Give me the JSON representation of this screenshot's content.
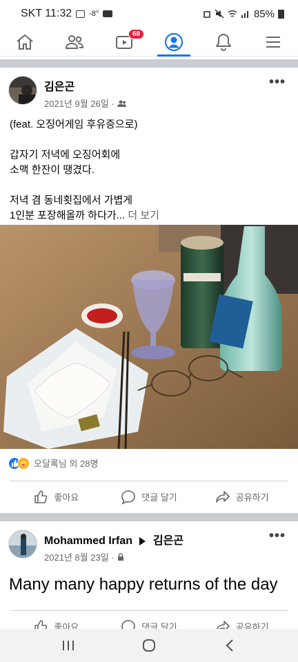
{
  "status": {
    "carrier_time": "SKT 11:32",
    "temp": "-8°",
    "battery": "85%"
  },
  "nav": {
    "video_badge": "68"
  },
  "post1": {
    "author": "김은곤",
    "date": "2021년 9월 26일 ·",
    "line1": "(feat. 오징어게임 후유증으로)",
    "line2": "갑자기 저녁에 오징어회에",
    "line3": "소맥 한잔이 땡겼다.",
    "line4": "저녁 겸 동네횟집에서 가볍게",
    "line5": "1인분 포장해올까 하다가...",
    "see_more": "더 보기",
    "reactions": "오달록님 외 28명"
  },
  "actions": {
    "like": "좋아요",
    "comment": "댓글 달기",
    "share": "공유하기"
  },
  "post2": {
    "author": "Mohammed Irfan",
    "target": "김은곤",
    "date": "2021년 8월 23일 ·",
    "text": "Many many happy returns of the day"
  },
  "colors": {
    "accent": "#1877f2",
    "badge": "#e41e3f"
  }
}
